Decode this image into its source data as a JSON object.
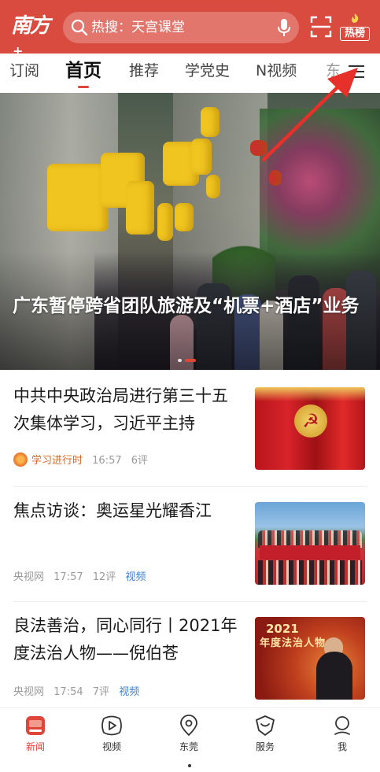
{
  "header": {
    "logo": "南方",
    "logo_plus": "+",
    "search_text": "热搜：天宫课堂",
    "hot_label": "热榜",
    "icons": [
      "search-icon",
      "microphone-icon",
      "scan-icon",
      "flame-icon"
    ],
    "bar_color": "#d94b3f"
  },
  "tabs": [
    {
      "label": "订阅",
      "active": false
    },
    {
      "label": "首页",
      "active": true
    },
    {
      "label": "推荐",
      "active": false
    },
    {
      "label": "学党史",
      "active": false
    },
    {
      "label": "N视频",
      "active": false
    },
    {
      "label": "东",
      "active": false
    }
  ],
  "hero": {
    "title": "广东暂停跨省团队旅游及“机票+酒店”业务",
    "slide_count": 2,
    "current_slide": 2
  },
  "news": [
    {
      "title": "中共中央政治局进行第三十五次集体学习，习近平主持",
      "source": "学习进行时",
      "time": "16:57",
      "comments": "6评",
      "tag": ""
    },
    {
      "title": "焦点访谈：奥运星光耀香江",
      "source": "央视网",
      "time": "17:57",
      "comments": "12评",
      "tag": "视频"
    },
    {
      "title": "良法善治，同心同行丨2021年度法治人物——倪伯苍",
      "source": "央视网",
      "time": "17:54",
      "comments": "7评",
      "tag": "视频",
      "thumb_year": "2021",
      "thumb_label": "年度法治人物"
    }
  ],
  "bottom_nav": [
    {
      "label": "新闻",
      "icon": "news-icon",
      "active": true
    },
    {
      "label": "视频",
      "icon": "video-icon",
      "active": false
    },
    {
      "label": "东莞",
      "icon": "location-icon",
      "active": false
    },
    {
      "label": "服务",
      "icon": "service-icon",
      "active": false
    },
    {
      "label": "我",
      "icon": "profile-icon",
      "active": false
    }
  ],
  "accent_color": "#e0453a",
  "link_color": "#3b7fd4"
}
